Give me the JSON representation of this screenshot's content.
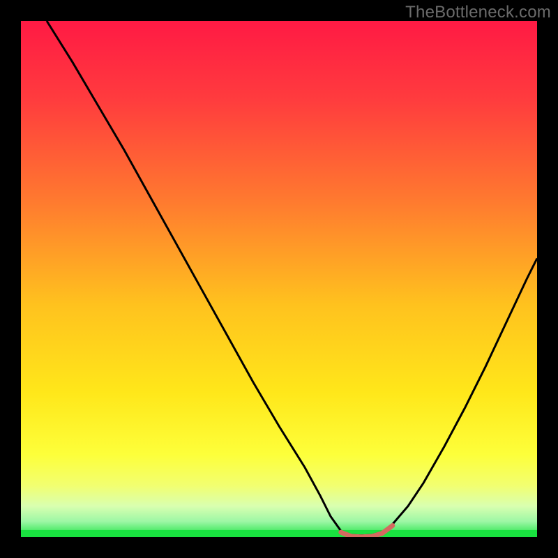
{
  "watermark": "TheBottleneck.com",
  "colors": {
    "curve": "#000000",
    "highlight": "#d46a60",
    "greenBand": "#19e240",
    "gradientStops": [
      {
        "offset": 0.0,
        "color": "#ff1a44"
      },
      {
        "offset": 0.15,
        "color": "#ff3b3e"
      },
      {
        "offset": 0.35,
        "color": "#ff7a2f"
      },
      {
        "offset": 0.55,
        "color": "#ffc21e"
      },
      {
        "offset": 0.72,
        "color": "#ffe71a"
      },
      {
        "offset": 0.84,
        "color": "#fdff3a"
      },
      {
        "offset": 0.9,
        "color": "#f2ff70"
      },
      {
        "offset": 0.94,
        "color": "#d9ffb0"
      },
      {
        "offset": 0.97,
        "color": "#9cf7a5"
      },
      {
        "offset": 1.0,
        "color": "#19e240"
      }
    ]
  },
  "chart_data": {
    "type": "line",
    "title": "",
    "xlabel": "",
    "ylabel": "",
    "x_range": [
      0,
      100
    ],
    "y_range": [
      0,
      100
    ],
    "highlight_band_x": [
      61,
      72
    ],
    "curve": [
      {
        "x": 5.0,
        "y": 100.0
      },
      {
        "x": 10.0,
        "y": 92.0
      },
      {
        "x": 15.0,
        "y": 83.5
      },
      {
        "x": 20.0,
        "y": 75.0
      },
      {
        "x": 25.0,
        "y": 66.0
      },
      {
        "x": 30.0,
        "y": 57.0
      },
      {
        "x": 35.0,
        "y": 48.0
      },
      {
        "x": 40.0,
        "y": 39.0
      },
      {
        "x": 45.0,
        "y": 30.0
      },
      {
        "x": 50.0,
        "y": 21.5
      },
      {
        "x": 55.0,
        "y": 13.5
      },
      {
        "x": 58.0,
        "y": 8.0
      },
      {
        "x": 60.0,
        "y": 4.0
      },
      {
        "x": 62.0,
        "y": 1.2
      },
      {
        "x": 64.0,
        "y": 0.4
      },
      {
        "x": 66.0,
        "y": 0.3
      },
      {
        "x": 68.0,
        "y": 0.4
      },
      {
        "x": 70.0,
        "y": 1.0
      },
      {
        "x": 72.0,
        "y": 2.5
      },
      {
        "x": 75.0,
        "y": 6.0
      },
      {
        "x": 78.0,
        "y": 10.5
      },
      {
        "x": 82.0,
        "y": 17.5
      },
      {
        "x": 86.0,
        "y": 25.0
      },
      {
        "x": 90.0,
        "y": 33.0
      },
      {
        "x": 94.0,
        "y": 41.5
      },
      {
        "x": 98.0,
        "y": 50.0
      },
      {
        "x": 100.0,
        "y": 54.0
      }
    ]
  }
}
